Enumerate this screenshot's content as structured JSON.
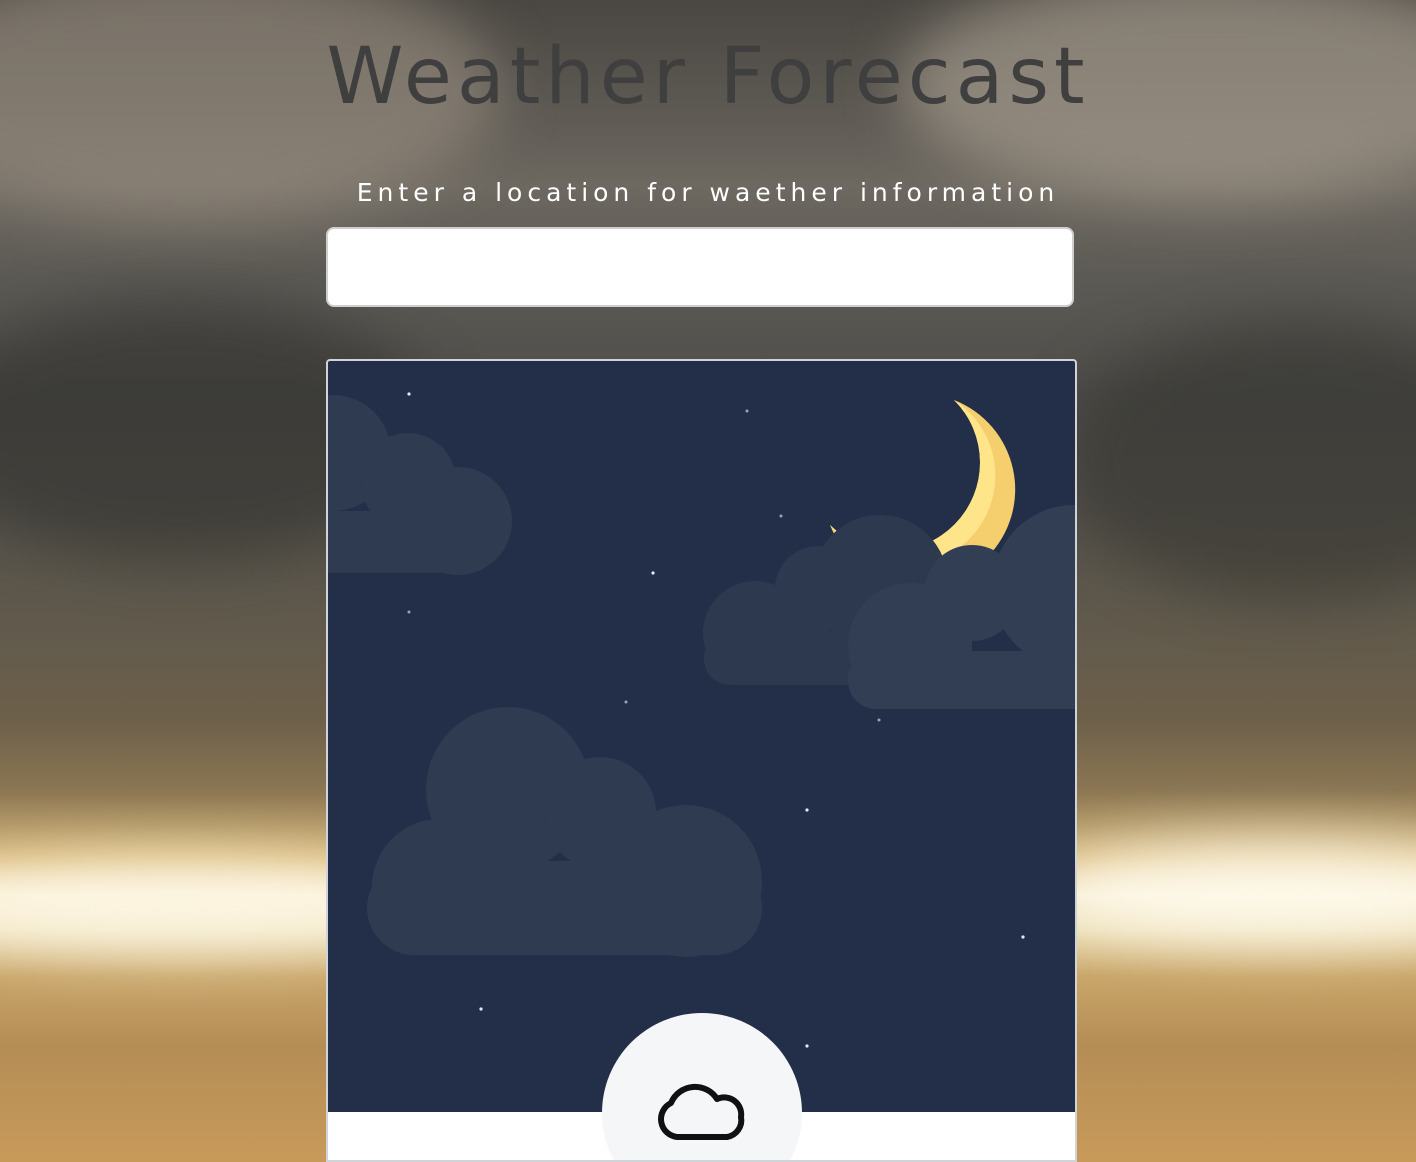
{
  "page": {
    "title": "Weather Forecast",
    "subtitle": "Enter a location for waether information"
  },
  "search": {
    "value": "",
    "placeholder": ""
  },
  "weather_card": {
    "illustration": "night-sky-moon-clouds",
    "condition_icon": "cloud-icon"
  },
  "colors": {
    "sky": "#232f49",
    "cloud": "#2f3b51",
    "moon": "#ffe58a",
    "moon_shade": "#f5cf6e",
    "title": "#3f3f3f",
    "subtitle": "#ffffff"
  }
}
